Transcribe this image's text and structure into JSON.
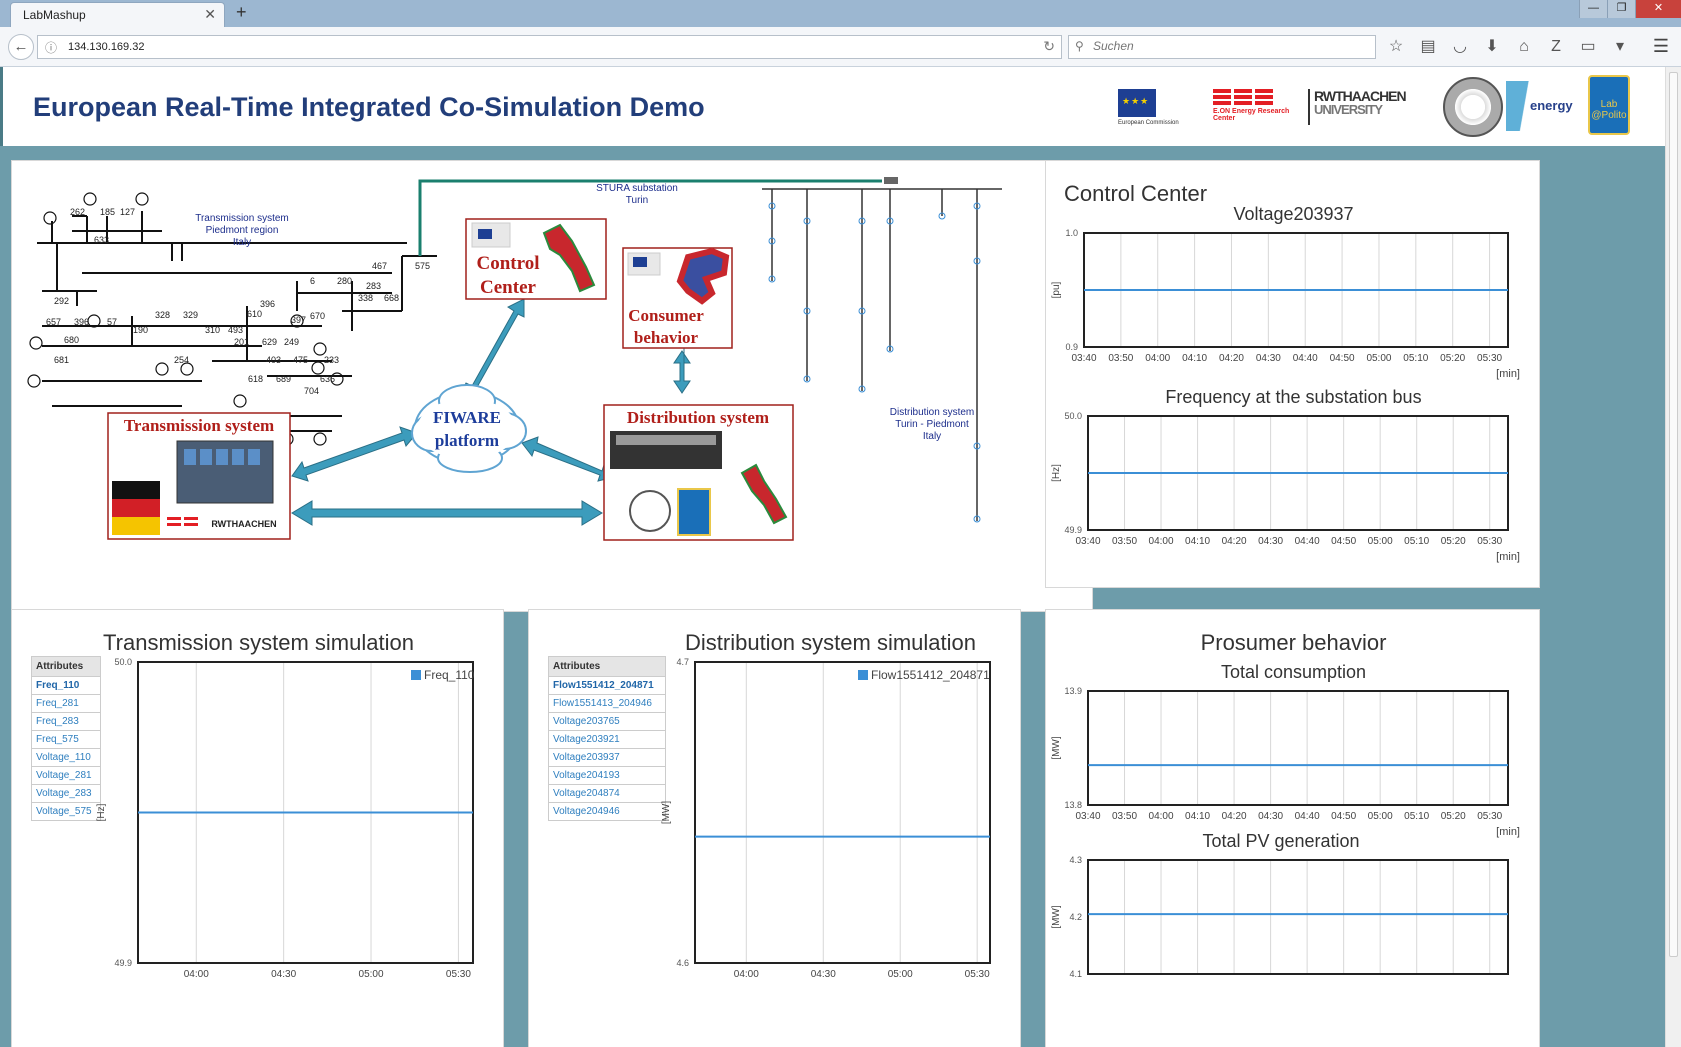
{
  "browser": {
    "tab_title": "LabMashup",
    "tab_close": "✕",
    "new_tab": "+",
    "url": "134.130.169.32",
    "search_placeholder": "Suchen"
  },
  "header": {
    "title": "European Real-Time Integrated Co-Simulation Demo",
    "logos": {
      "ec": "European Commission",
      "eon": "E.ON Energy Research Center",
      "rwth_top": "RWTHAACHEN",
      "rwth_bottom": "UNIVERSITY",
      "energy": "energy",
      "lab": "Lab @Polito"
    }
  },
  "architecture": {
    "transmission_map_title": [
      "Transmission system",
      "Piedmont region",
      "Italy"
    ],
    "substation": [
      "STURA substation",
      "Turin"
    ],
    "distribution_map_title": [
      "Distribution system",
      "Turin - Piedmont",
      "Italy"
    ],
    "boxes": {
      "control_center": [
        "Control",
        "Center"
      ],
      "consumer_behavior": [
        "Consumer",
        "behavior"
      ],
      "transmission": "Transmission system",
      "distribution": "Distribution system",
      "fiware": [
        "FIWARE",
        "platform"
      ]
    },
    "bus_numbers": [
      "262",
      "185",
      "127",
      "633",
      "467",
      "575",
      "6",
      "280",
      "283",
      "292",
      "338",
      "668",
      "396",
      "397",
      "670",
      "57",
      "328",
      "329",
      "610",
      "657",
      "396",
      "190",
      "310",
      "493",
      "201",
      "629",
      "249",
      "680",
      "233",
      "681",
      "254",
      "403",
      "475",
      "618",
      "689",
      "636",
      "704"
    ],
    "colors": {
      "box_border": "#a0201b",
      "title_red": "#b01f1a",
      "arrow": "#3c9cbc",
      "fiware_blue": "#1d3d9b"
    }
  },
  "control_center": {
    "title": "Control Center",
    "charts": [
      {
        "title": "Voltage203937",
        "ylabel": "[pu]",
        "xunit": "[min]",
        "ytick_top": "1.0",
        "ytick_bottom": "0.9",
        "xticks": [
          "03:40",
          "03:50",
          "04:00",
          "04:10",
          "04:20",
          "04:30",
          "04:40",
          "04:50",
          "05:00",
          "05:10",
          "05:20",
          "05:30"
        ]
      },
      {
        "title": "Frequency at the substation bus",
        "ylabel": "[Hz]",
        "xunit": "[min]",
        "ytick_top": "50.0",
        "ytick_bottom": "49.9",
        "xticks": [
          "03:40",
          "03:50",
          "04:00",
          "04:10",
          "04:20",
          "04:30",
          "04:40",
          "04:50",
          "05:00",
          "05:10",
          "05:20",
          "05:30"
        ]
      }
    ]
  },
  "transmission_sim": {
    "title": "Transmission system simulation",
    "attributes_header": "Attributes",
    "attributes": [
      "Freq_110",
      "Freq_281",
      "Freq_283",
      "Freq_575",
      "Voltage_110",
      "Voltage_281",
      "Voltage_283",
      "Voltage_575"
    ],
    "selected": "Freq_110",
    "chart": {
      "legend": "Freq_110",
      "ylabel": "[Hz]",
      "ytick_top": "50.0",
      "ytick_bottom": "49.9",
      "xticks": [
        "04:00",
        "04:30",
        "05:00",
        "05:30"
      ]
    }
  },
  "distribution_sim": {
    "title": "Distribution system simulation",
    "attributes_header": "Attributes",
    "attributes": [
      "Flow1551412_204871",
      "Flow1551413_204946",
      "Voltage203765",
      "Voltage203921",
      "Voltage203937",
      "Voltage204193",
      "Voltage204874",
      "Voltage204946"
    ],
    "selected": "Flow1551412_204871",
    "chart": {
      "legend": "Flow1551412_204871",
      "ylabel": "[MW]",
      "ytick_top": "4.7",
      "ytick_bottom": "4.6",
      "xticks": [
        "04:00",
        "04:30",
        "05:00",
        "05:30"
      ]
    }
  },
  "prosumer": {
    "title": "Prosumer behavior",
    "charts": [
      {
        "title": "Total consumption",
        "ylabel": "[MW]",
        "xunit": "[min]",
        "ytick_top": "13.9",
        "ytick_bottom": "13.8",
        "xticks": [
          "03:40",
          "03:50",
          "04:00",
          "04:10",
          "04:20",
          "04:30",
          "04:40",
          "04:50",
          "05:00",
          "05:10",
          "05:20",
          "05:30"
        ]
      },
      {
        "title": "Total PV generation",
        "ylabel": "[MW]",
        "ytick_top": "4.3",
        "ytick_mid": "4.2",
        "ytick_bottom": "4.1"
      }
    ]
  },
  "chart_data": [
    {
      "type": "line",
      "title": "Voltage203937",
      "ylabel": "[pu]",
      "xlabel": "[min]",
      "ylim": [
        0.9,
        1.0
      ],
      "x": [
        "03:40",
        "05:35"
      ],
      "series": [
        {
          "values": [
            0.95,
            0.95
          ]
        }
      ],
      "grid": true
    },
    {
      "type": "line",
      "title": "Frequency at the substation bus",
      "ylabel": "[Hz]",
      "xlabel": "[min]",
      "ylim": [
        49.9,
        50.0
      ],
      "x": [
        "03:40",
        "05:35"
      ],
      "series": [
        {
          "values": [
            49.95,
            49.95
          ]
        }
      ],
      "grid": true
    },
    {
      "type": "line",
      "title": "Transmission system simulation",
      "ylabel": "[Hz]",
      "ylim": [
        49.9,
        50.0
      ],
      "x": [
        "03:40",
        "05:35"
      ],
      "series": [
        {
          "name": "Freq_110",
          "values": [
            49.95,
            49.95
          ]
        }
      ],
      "grid": true,
      "legend": "top-right"
    },
    {
      "type": "line",
      "title": "Distribution system simulation",
      "ylabel": "[MW]",
      "ylim": [
        4.6,
        4.7
      ],
      "x": [
        "03:40",
        "05:35"
      ],
      "series": [
        {
          "name": "Flow1551412_204871",
          "values": [
            4.642,
            4.642
          ]
        }
      ],
      "grid": true,
      "legend": "top-right"
    },
    {
      "type": "line",
      "title": "Total consumption",
      "ylabel": "[MW]",
      "xlabel": "[min]",
      "ylim": [
        13.8,
        13.9
      ],
      "x": [
        "03:40",
        "05:35"
      ],
      "series": [
        {
          "values": [
            13.835,
            13.835
          ]
        }
      ],
      "grid": true
    },
    {
      "type": "line",
      "title": "Total PV generation",
      "ylabel": "[MW]",
      "ylim": [
        4.1,
        4.3
      ],
      "x": [
        "03:40",
        "05:35"
      ],
      "series": [
        {
          "values": [
            4.205,
            4.205
          ]
        }
      ],
      "grid": true
    }
  ],
  "colors": {
    "page_bg": "#6d9caa",
    "title_blue": "#223e7a",
    "series_line": "#3b8fd6",
    "link_blue": "#2f7fbf"
  }
}
